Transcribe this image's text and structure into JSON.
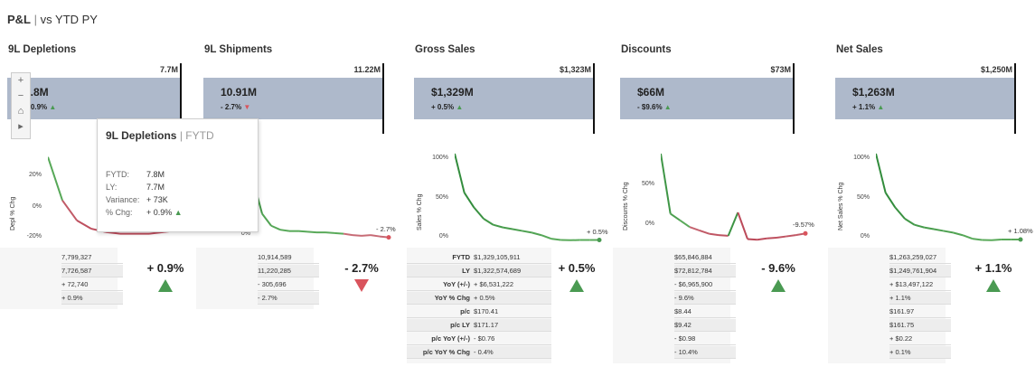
{
  "header": {
    "title": "P&L",
    "sep": "|",
    "subtitle": "vs YTD PY"
  },
  "panels": [
    {
      "title": "9L Depletions",
      "bar_total": "7.7M",
      "bar_value": "7.8M",
      "bar_change": "+ 0.9%",
      "bar_arrow": "up",
      "y_ticks": [
        "20%",
        "0%",
        "-20%"
      ],
      "y_axis_label": "Depl % Chg",
      "end_label": "",
      "table_rows": [
        "7,799,327",
        "7,726,587",
        "+ 72,740",
        "+ 0.9%"
      ],
      "big_change": "+ 0.9%",
      "big_arrow": "up"
    },
    {
      "title": "9L Shipments",
      "bar_total": "11.22M",
      "bar_value": "10.91M",
      "bar_change": "- 2.7%",
      "bar_arrow": "down",
      "y_ticks": [
        "0%"
      ],
      "y_axis_label": "",
      "end_label": "- 2.7%",
      "table_rows": [
        "10,914,589",
        "11,220,285",
        "- 305,696",
        "- 2.7%"
      ],
      "big_change": "- 2.7%",
      "big_arrow": "down"
    },
    {
      "title": "Gross Sales",
      "bar_total": "$1,323M",
      "bar_value": "$1,329M",
      "bar_change": "+ 0.5%",
      "bar_arrow": "up",
      "y_ticks": [
        "100%",
        "50%",
        "0%"
      ],
      "y_axis_label": "Sales % Chg",
      "end_label": "+ 0.5%",
      "row_labels": [
        "FYTD",
        "LY",
        "YoY (+/-)",
        "YoY % Chg",
        "p/c",
        "p/c LY",
        "p/c YoY (+/-)",
        "p/c YoY % Chg"
      ],
      "table_rows": [
        "$1,329,105,911",
        "$1,322,574,689",
        "+ $6,531,222",
        "+ 0.5%",
        "$170.41",
        "$171.17",
        "- $0.76",
        "- 0.4%"
      ],
      "big_change": "+ 0.5%",
      "big_arrow": "up"
    },
    {
      "title": "Discounts",
      "bar_total": "$73M",
      "bar_value": "$66M",
      "bar_change": "- $9.6%",
      "bar_arrow": "up",
      "y_ticks": [
        "50%",
        "0%"
      ],
      "y_axis_label": "Discounts % Chg",
      "end_label": "-9.57%",
      "table_rows": [
        "$65,846,884",
        "$72,812,784",
        "- $6,965,900",
        "- 9.6%",
        "$8.44",
        "$9.42",
        "- $0.98",
        "- 10.4%"
      ],
      "big_change": "- 9.6%",
      "big_arrow": "up"
    },
    {
      "title": "Net Sales",
      "bar_total": "$1,250M",
      "bar_value": "$1,263M",
      "bar_change": "+ 1.1%",
      "bar_arrow": "up",
      "y_ticks": [
        "100%",
        "50%",
        "0%"
      ],
      "y_axis_label": "Net Sales % Chg",
      "end_label": "+ 1.08%",
      "table_rows": [
        "$1,263,259,027",
        "$1,249,761,904",
        "+ $13,497,122",
        "+ 1.1%",
        "$161.97",
        "$161.75",
        "+ $0.22",
        "+ 0.1%"
      ],
      "big_change": "+ 1.1%",
      "big_arrow": "up"
    }
  ],
  "tooltip": {
    "title": "9L Depletions",
    "sep": "|",
    "subtitle": "FYTD",
    "rows": [
      {
        "k": "FYTD:",
        "v": "7.8M"
      },
      {
        "k": "LY:",
        "v": "7.7M"
      },
      {
        "k": "Variance:",
        "v": "+ 73K"
      },
      {
        "k": "% Chg:",
        "v": "+ 0.9%"
      }
    ]
  },
  "zoom_controls": [
    "+",
    "−",
    "⌂",
    "▸"
  ],
  "colors": {
    "bar": "#aeb9cb",
    "up": "#4a9a52",
    "down": "#d9545d"
  },
  "chart_data": [
    {
      "type": "line",
      "title": "",
      "ylabel": "Depl % Chg",
      "series": [
        {
          "values": [
            28,
            2,
            -10,
            -15,
            -17,
            -18,
            -18,
            -18,
            -17,
            -16,
            -15
          ]
        }
      ],
      "ylim": [
        -22,
        30
      ]
    },
    {
      "type": "line",
      "title": "",
      "ylabel": "",
      "series": [
        {
          "values": [
            60,
            40,
            15,
            6,
            3,
            2,
            2,
            1.5,
            1,
            1,
            0.5,
            0,
            -1,
            -1.5,
            -1,
            -2,
            -2.7
          ]
        }
      ],
      "ylim": [
        -5,
        60
      ]
    },
    {
      "type": "line",
      "title": "",
      "ylabel": "Sales % Chg",
      "series": [
        {
          "values": [
            100,
            55,
            38,
            25,
            18,
            15,
            13,
            11,
            9,
            6,
            2,
            0.5,
            0.2,
            0.5,
            0.5,
            0.5
          ]
        }
      ],
      "ylim": [
        0,
        100
      ]
    },
    {
      "type": "line",
      "title": "",
      "ylabel": "Discounts % Chg",
      "series": [
        {
          "values": [
            110,
            20,
            10,
            0,
            -5,
            -10,
            -12,
            -13,
            22,
            -18,
            -19,
            -17,
            -16,
            -14,
            -12,
            -9.57
          ]
        }
      ],
      "ylim": [
        -20,
        110
      ]
    },
    {
      "type": "line",
      "title": "",
      "ylabel": "Net Sales % Chg",
      "series": [
        {
          "values": [
            100,
            55,
            38,
            25,
            18,
            15,
            13,
            11,
            9,
            6,
            2,
            0.5,
            0.3,
            1,
            1.05,
            1.08
          ]
        }
      ],
      "ylim": [
        0,
        100
      ]
    }
  ]
}
